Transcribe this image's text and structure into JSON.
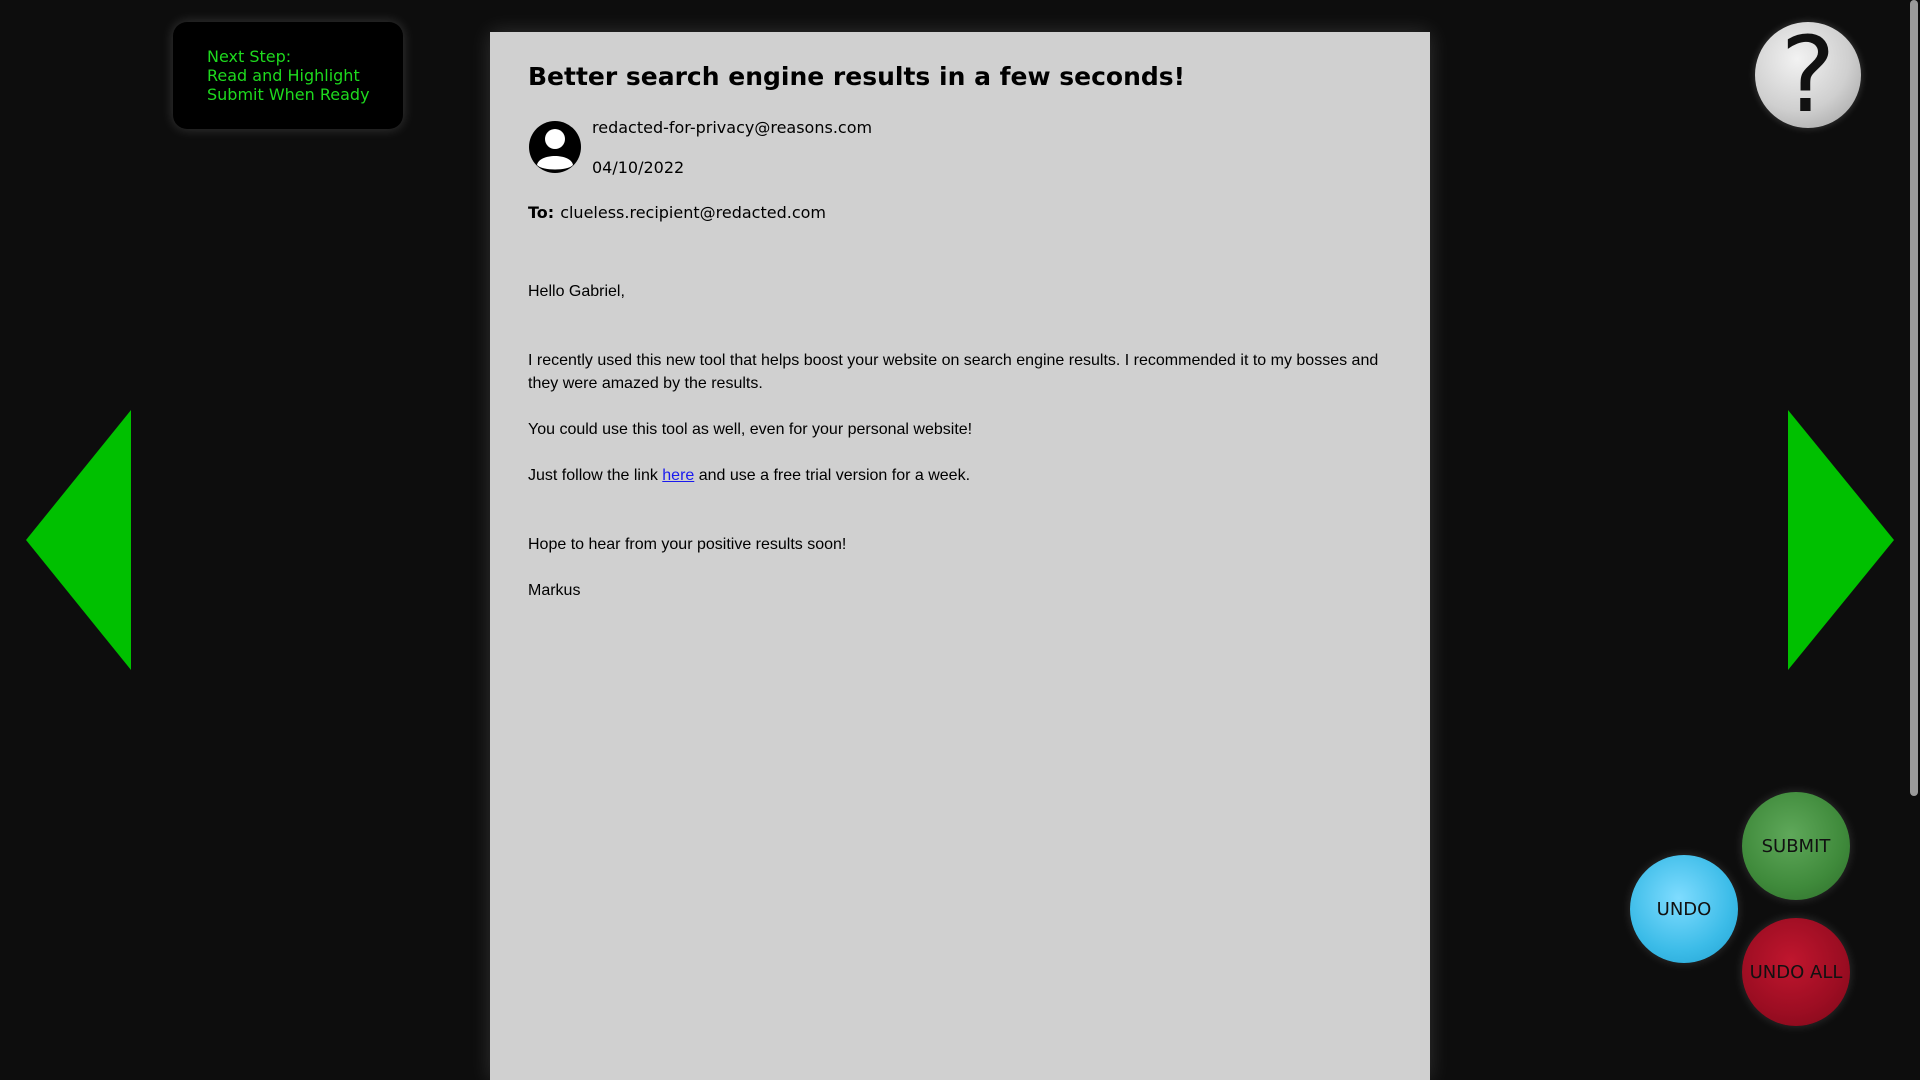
{
  "next_step": {
    "line1": "Next Step:",
    "line2": "Read and Highlight",
    "line3": "Submit When Ready",
    "color": "#1ed91e"
  },
  "email": {
    "subject": "Better search engine results in a few seconds!",
    "sender": "redacted-for-privacy@reasons.com",
    "date": "04/10/2022",
    "to_label": "To:",
    "to_address": "clueless.recipient@redacted.com",
    "greeting": "Hello Gabriel,",
    "paragraph1": "I recently used this new tool that helps boost your website on search engine results. I recommended it to my bosses and they were amazed by the results.",
    "paragraph2": "You could use this tool as well, even for your personal website!",
    "paragraph3_before": "Just follow the link ",
    "paragraph3_link": "here",
    "paragraph3_after": " and use a free trial version for a week.",
    "closing": "Hope to hear from your positive results soon!",
    "signature": "Markus",
    "avatar_icon": "user-avatar-icon"
  },
  "navigation": {
    "prev_icon": "arrow-left-icon",
    "next_icon": "arrow-right-icon",
    "arrow_color": "#00c000"
  },
  "help": {
    "label": "?",
    "icon": "help-icon"
  },
  "actions": {
    "submit_label": "SUBMIT",
    "undo_label": "UNDO",
    "undo_all_label": "UNDO ALL",
    "submit_color": "#3f8a3b",
    "undo_color": "#3cbce8",
    "undo_all_color": "#9b0d22"
  }
}
